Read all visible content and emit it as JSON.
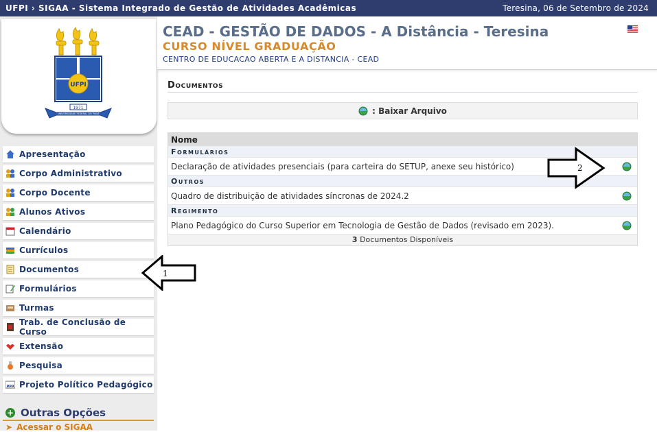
{
  "topbar": {
    "title": "UFPI › SIGAA - Sistema Integrado de Gestão de Atividades Acadêmicas",
    "date": "Teresina, 06 de Setembro de 2024"
  },
  "logo": {
    "text": "UFPI",
    "year": "1971",
    "ribbon": "UNIVERSIDADE FEDERAL DO PIAUÍ"
  },
  "header": {
    "title": "CEAD - GESTÃO DE DADOS - A Distância - Teresina",
    "subtitle": "CURSO NÍVEL GRADUAÇÃO",
    "center": "CENTRO DE EDUCACAO ABERTA E A DISTANCIA - CEAD",
    "flag_icon": "us-flag-icon"
  },
  "sidebar": {
    "items": [
      {
        "label": "Apresentação",
        "icon": "home-icon"
      },
      {
        "label": "Corpo Administrativo",
        "icon": "people-icon"
      },
      {
        "label": "Corpo Docente",
        "icon": "people-icon"
      },
      {
        "label": "Alunos Ativos",
        "icon": "people-icon"
      },
      {
        "label": "Calendário",
        "icon": "calendar-icon"
      },
      {
        "label": "Currículos",
        "icon": "books-icon"
      },
      {
        "label": "Documentos",
        "icon": "document-icon"
      },
      {
        "label": "Formulários",
        "icon": "form-icon"
      },
      {
        "label": "Turmas",
        "icon": "class-icon"
      },
      {
        "label": "Trab. de Conclusão de Curso",
        "icon": "thesis-icon"
      },
      {
        "label": "Extensão",
        "icon": "extension-icon"
      },
      {
        "label": "Pesquisa",
        "icon": "research-icon"
      },
      {
        "label": "Projeto Político Pedagógico",
        "icon": "ppp-icon"
      }
    ],
    "outras": "Outras Opções",
    "acessar": "Acessar o SIGAA"
  },
  "content": {
    "section_title": "Documentos",
    "legend": ": Baixar Arquivo",
    "table_header": "Nome",
    "groups": [
      {
        "name": "Formulários",
        "docs": [
          "Declaração de atividades presenciais (para carteira do SETUP, anexe seu histórico)"
        ]
      },
      {
        "name": "Outros",
        "docs": [
          "Quadro de distribuição de atividades síncronas de 2024.2"
        ]
      },
      {
        "name": "Regimento",
        "docs": [
          "Plano Pedagógico do Curso Superior em Tecnologia de Gestão de Dados (revisado em 2023)."
        ]
      }
    ],
    "footer_count": "3",
    "footer_text": "Documentos  Disponíveis"
  },
  "annotations": {
    "arrow1": "1",
    "arrow2": "2"
  },
  "colors": {
    "topbar": "#2f3d6e",
    "title": "#5a6e8a",
    "subtitle": "#d7892b",
    "menu_text": "#1e3a6e",
    "accent": "#d77d12"
  }
}
